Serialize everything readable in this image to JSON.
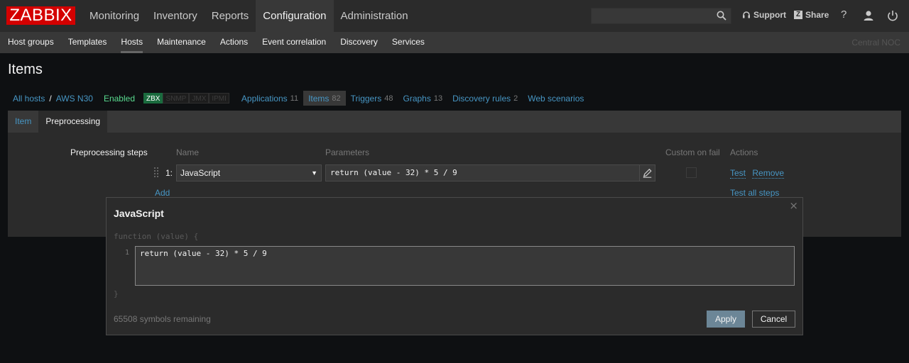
{
  "logo": "ZABBIX",
  "main_menu": [
    {
      "label": "Monitoring",
      "active": false
    },
    {
      "label": "Inventory",
      "active": false
    },
    {
      "label": "Reports",
      "active": false
    },
    {
      "label": "Configuration",
      "active": true
    },
    {
      "label": "Administration",
      "active": false
    }
  ],
  "topbar": {
    "search_value": "",
    "support_label": "Support",
    "share_label": "Share",
    "share_badge": "Z",
    "help_label": "?"
  },
  "sub_menu": [
    {
      "label": "Host groups",
      "active": false
    },
    {
      "label": "Templates",
      "active": false
    },
    {
      "label": "Hosts",
      "active": true
    },
    {
      "label": "Maintenance",
      "active": false
    },
    {
      "label": "Actions",
      "active": false
    },
    {
      "label": "Event correlation",
      "active": false
    },
    {
      "label": "Discovery",
      "active": false
    },
    {
      "label": "Services",
      "active": false
    }
  ],
  "server_name": "Central NOC",
  "page_title": "Items",
  "breadcrumbs": {
    "all_hosts": "All hosts",
    "separator": "/",
    "host": "AWS N30",
    "status": "Enabled",
    "tags": [
      {
        "label": "ZBX",
        "on": true
      },
      {
        "label": "SNMP",
        "on": false
      },
      {
        "label": "JMX",
        "on": false
      },
      {
        "label": "IPMI",
        "on": false
      }
    ],
    "applications": {
      "label": "Applications",
      "count": "11"
    },
    "items": {
      "label": "Items",
      "count": "82"
    },
    "triggers": {
      "label": "Triggers",
      "count": "48"
    },
    "graphs": {
      "label": "Graphs",
      "count": "13"
    },
    "discovery": {
      "label": "Discovery rules",
      "count": "2"
    },
    "web": {
      "label": "Web scenarios"
    }
  },
  "form_tabs": [
    {
      "label": "Item",
      "active": false
    },
    {
      "label": "Preprocessing",
      "active": true
    }
  ],
  "preprocessing": {
    "section_label": "Preprocessing steps",
    "col_name": "Name",
    "col_params": "Parameters",
    "col_custom": "Custom on fail",
    "col_actions": "Actions",
    "step_number": "1:",
    "step_name": "JavaScript",
    "step_params": "return (value - 32) * 5 / 9",
    "test_label": "Test",
    "remove_label": "Remove",
    "add_label": "Add",
    "test_all_label": "Test all steps"
  },
  "modal": {
    "title": "JavaScript",
    "close": "×",
    "code_head": "function (value) {",
    "line_number": "1",
    "code": "return (value - 32) * 5 / 9",
    "code_foot": "}",
    "remaining": "65508 symbols remaining",
    "apply_label": "Apply",
    "cancel_label": "Cancel"
  },
  "colors": {
    "logo_red": "#d40000",
    "link_blue": "#4796c4",
    "enabled_green": "#59db8f",
    "apply_button": "#6c8697"
  }
}
